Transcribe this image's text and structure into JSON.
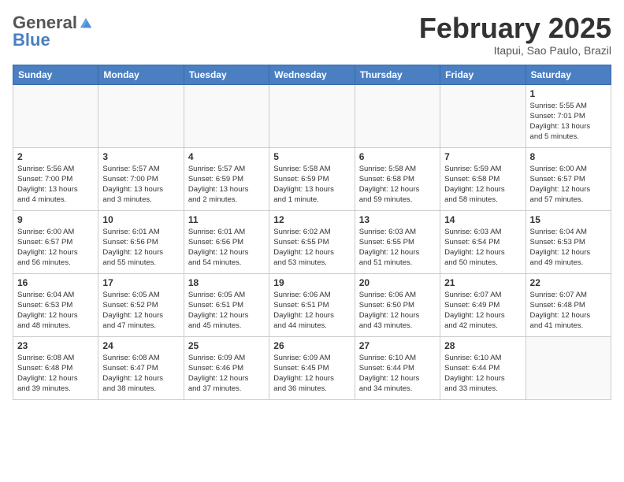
{
  "header": {
    "logo_general": "General",
    "logo_blue": "Blue",
    "month_title": "February 2025",
    "location": "Itapui, Sao Paulo, Brazil"
  },
  "weekdays": [
    "Sunday",
    "Monday",
    "Tuesday",
    "Wednesday",
    "Thursday",
    "Friday",
    "Saturday"
  ],
  "weeks": [
    [
      {
        "day": "",
        "info": ""
      },
      {
        "day": "",
        "info": ""
      },
      {
        "day": "",
        "info": ""
      },
      {
        "day": "",
        "info": ""
      },
      {
        "day": "",
        "info": ""
      },
      {
        "day": "",
        "info": ""
      },
      {
        "day": "1",
        "info": "Sunrise: 5:55 AM\nSunset: 7:01 PM\nDaylight: 13 hours\nand 5 minutes."
      }
    ],
    [
      {
        "day": "2",
        "info": "Sunrise: 5:56 AM\nSunset: 7:00 PM\nDaylight: 13 hours\nand 4 minutes."
      },
      {
        "day": "3",
        "info": "Sunrise: 5:57 AM\nSunset: 7:00 PM\nDaylight: 13 hours\nand 3 minutes."
      },
      {
        "day": "4",
        "info": "Sunrise: 5:57 AM\nSunset: 6:59 PM\nDaylight: 13 hours\nand 2 minutes."
      },
      {
        "day": "5",
        "info": "Sunrise: 5:58 AM\nSunset: 6:59 PM\nDaylight: 13 hours\nand 1 minute."
      },
      {
        "day": "6",
        "info": "Sunrise: 5:58 AM\nSunset: 6:58 PM\nDaylight: 12 hours\nand 59 minutes."
      },
      {
        "day": "7",
        "info": "Sunrise: 5:59 AM\nSunset: 6:58 PM\nDaylight: 12 hours\nand 58 minutes."
      },
      {
        "day": "8",
        "info": "Sunrise: 6:00 AM\nSunset: 6:57 PM\nDaylight: 12 hours\nand 57 minutes."
      }
    ],
    [
      {
        "day": "9",
        "info": "Sunrise: 6:00 AM\nSunset: 6:57 PM\nDaylight: 12 hours\nand 56 minutes."
      },
      {
        "day": "10",
        "info": "Sunrise: 6:01 AM\nSunset: 6:56 PM\nDaylight: 12 hours\nand 55 minutes."
      },
      {
        "day": "11",
        "info": "Sunrise: 6:01 AM\nSunset: 6:56 PM\nDaylight: 12 hours\nand 54 minutes."
      },
      {
        "day": "12",
        "info": "Sunrise: 6:02 AM\nSunset: 6:55 PM\nDaylight: 12 hours\nand 53 minutes."
      },
      {
        "day": "13",
        "info": "Sunrise: 6:03 AM\nSunset: 6:55 PM\nDaylight: 12 hours\nand 51 minutes."
      },
      {
        "day": "14",
        "info": "Sunrise: 6:03 AM\nSunset: 6:54 PM\nDaylight: 12 hours\nand 50 minutes."
      },
      {
        "day": "15",
        "info": "Sunrise: 6:04 AM\nSunset: 6:53 PM\nDaylight: 12 hours\nand 49 minutes."
      }
    ],
    [
      {
        "day": "16",
        "info": "Sunrise: 6:04 AM\nSunset: 6:53 PM\nDaylight: 12 hours\nand 48 minutes."
      },
      {
        "day": "17",
        "info": "Sunrise: 6:05 AM\nSunset: 6:52 PM\nDaylight: 12 hours\nand 47 minutes."
      },
      {
        "day": "18",
        "info": "Sunrise: 6:05 AM\nSunset: 6:51 PM\nDaylight: 12 hours\nand 45 minutes."
      },
      {
        "day": "19",
        "info": "Sunrise: 6:06 AM\nSunset: 6:51 PM\nDaylight: 12 hours\nand 44 minutes."
      },
      {
        "day": "20",
        "info": "Sunrise: 6:06 AM\nSunset: 6:50 PM\nDaylight: 12 hours\nand 43 minutes."
      },
      {
        "day": "21",
        "info": "Sunrise: 6:07 AM\nSunset: 6:49 PM\nDaylight: 12 hours\nand 42 minutes."
      },
      {
        "day": "22",
        "info": "Sunrise: 6:07 AM\nSunset: 6:48 PM\nDaylight: 12 hours\nand 41 minutes."
      }
    ],
    [
      {
        "day": "23",
        "info": "Sunrise: 6:08 AM\nSunset: 6:48 PM\nDaylight: 12 hours\nand 39 minutes."
      },
      {
        "day": "24",
        "info": "Sunrise: 6:08 AM\nSunset: 6:47 PM\nDaylight: 12 hours\nand 38 minutes."
      },
      {
        "day": "25",
        "info": "Sunrise: 6:09 AM\nSunset: 6:46 PM\nDaylight: 12 hours\nand 37 minutes."
      },
      {
        "day": "26",
        "info": "Sunrise: 6:09 AM\nSunset: 6:45 PM\nDaylight: 12 hours\nand 36 minutes."
      },
      {
        "day": "27",
        "info": "Sunrise: 6:10 AM\nSunset: 6:44 PM\nDaylight: 12 hours\nand 34 minutes."
      },
      {
        "day": "28",
        "info": "Sunrise: 6:10 AM\nSunset: 6:44 PM\nDaylight: 12 hours\nand 33 minutes."
      },
      {
        "day": "",
        "info": ""
      }
    ]
  ]
}
